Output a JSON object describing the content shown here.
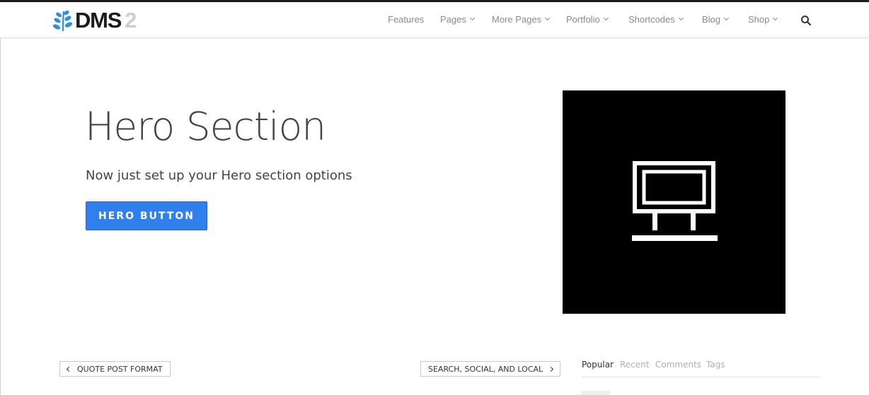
{
  "logo": {
    "text": "DMS",
    "number": "2",
    "icon": "leaf-icon"
  },
  "nav": {
    "items": [
      {
        "label": "Features",
        "has_dropdown": false
      },
      {
        "label": "Pages",
        "has_dropdown": true
      },
      {
        "label": "More Pages",
        "has_dropdown": true
      },
      {
        "label": "Portfolio",
        "has_dropdown": true
      },
      {
        "label": "Shortcodes",
        "has_dropdown": true
      },
      {
        "label": "Blog",
        "has_dropdown": true
      },
      {
        "label": "Shop",
        "has_dropdown": true
      }
    ],
    "search_icon": "search-icon"
  },
  "hero": {
    "title": "Hero Section",
    "subtitle": "Now just set up your Hero section options",
    "button_label": "HERO BUTTON",
    "image_icon": "monitor-icon"
  },
  "post_nav": {
    "prev_label": "QUOTE POST FORMAT",
    "next_label": "SEARCH, SOCIAL, AND LOCAL"
  },
  "sidebar_tabs": {
    "items": [
      {
        "label": "Popular",
        "active": true
      },
      {
        "label": "Recent",
        "active": false
      },
      {
        "label": "Comments",
        "active": false
      },
      {
        "label": "Tags",
        "active": false
      }
    ]
  },
  "colors": {
    "accent": "#2f80ed",
    "text": "#444444",
    "nav_text": "#8a8a8a",
    "image_bg": "#000000"
  }
}
